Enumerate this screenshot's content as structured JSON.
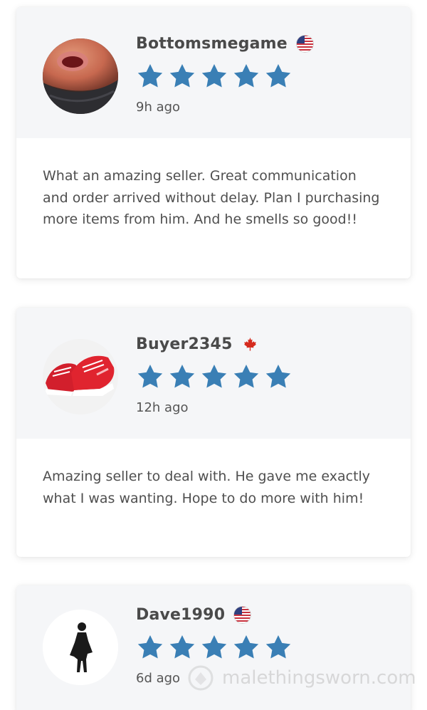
{
  "reviews": [
    {
      "username": "Bottomsmegame",
      "country": "United States",
      "flag_icon": "us-flag-icon",
      "rating": 5,
      "rating_max": 5,
      "time": "9h ago",
      "avatar": "photo-open-mouth",
      "text": "What an amazing seller. Great communication and order arrived without delay. Plan I purchasing more items from him. And he smells so good!!"
    },
    {
      "username": "Buyer2345",
      "country": "Canada",
      "flag_icon": "canada-flag-icon",
      "rating": 5,
      "rating_max": 5,
      "time": "12h ago",
      "avatar": "photo-red-sneakers",
      "text": "Amazing seller to deal with. He gave me exactly what I was wanting. Hope to do more with him!"
    },
    {
      "username": "Dave1990",
      "country": "United States",
      "flag_icon": "us-flag-icon",
      "rating": 5,
      "rating_max": 5,
      "time": "6d ago",
      "avatar": "female-silhouette-icon",
      "text": ""
    }
  ],
  "watermark": "malethingsworn.com",
  "colors": {
    "star": "#3a7fb5",
    "card_header_bg": "#f5f6f8",
    "username": "#4a4a4a",
    "body_text": "#4f4f4f"
  }
}
